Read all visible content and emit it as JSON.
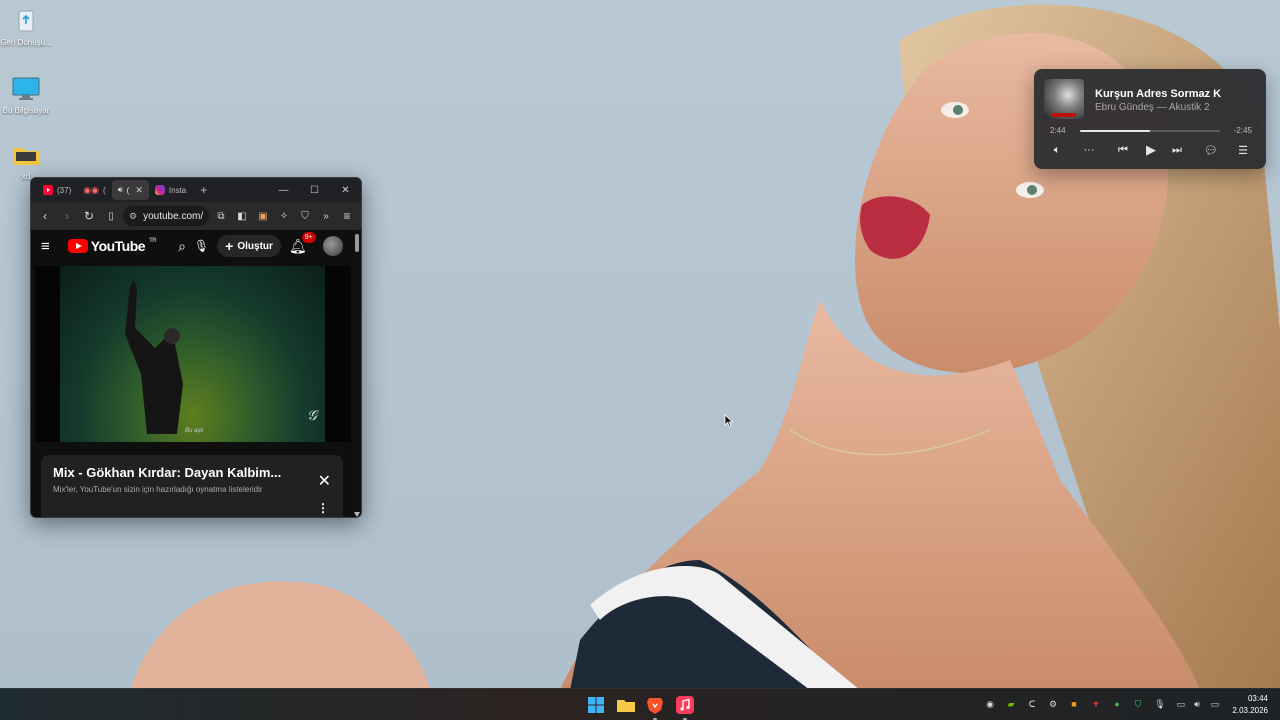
{
  "desktop": {
    "icons": [
      {
        "name": "recycle-bin",
        "label": "Geri Dönüşü..."
      },
      {
        "name": "this-pc",
        "label": "Bu Bilgisayar"
      },
      {
        "name": "folder",
        "label": "xd"
      }
    ]
  },
  "browser": {
    "tabs": [
      {
        "label": "(37)",
        "icon": "youtube-favicon"
      },
      {
        "label": "(",
        "icon": "recording-favicon"
      },
      {
        "label": "(",
        "icon": "speaker-icon",
        "active": true
      },
      {
        "label": "Insta",
        "icon": "instagram-favicon"
      }
    ],
    "address": "youtube.com/...",
    "youtube": {
      "logo_text": "YouTube",
      "region": "TR",
      "create_label": "Oluştur",
      "notification_count": "9+",
      "video_caption": "Bu aşk",
      "mix_title": "Mix - Gökhan Kırdar: Dayan Kalbim...",
      "mix_subtitle": "Mix'ler, YouTube'un sizin için hazırladığı oynatma listeleridir"
    }
  },
  "music_widget": {
    "title": "Kurşun Adres Sormaz K",
    "artist": "Ebru Gündeş — Akustik 2",
    "elapsed": "2:44",
    "remaining": "-2:45",
    "progress": 0.5,
    "controls": [
      "volume-icon",
      "more-icon",
      "previous-icon",
      "play-icon",
      "next-icon",
      "lyrics-icon",
      "queue-icon"
    ]
  },
  "taskbar": {
    "apps": [
      "start-icon",
      "file-explorer-icon",
      "brave-browser-icon",
      "apple-music-icon"
    ],
    "time": "03:44",
    "date": "2.03.2026"
  },
  "colors": {
    "wallpaper": "#b6c6d1",
    "youtube_red": "#ff0000",
    "music_widget_bg": "#2c2c2e",
    "taskbar_bg": "#242a2c"
  }
}
